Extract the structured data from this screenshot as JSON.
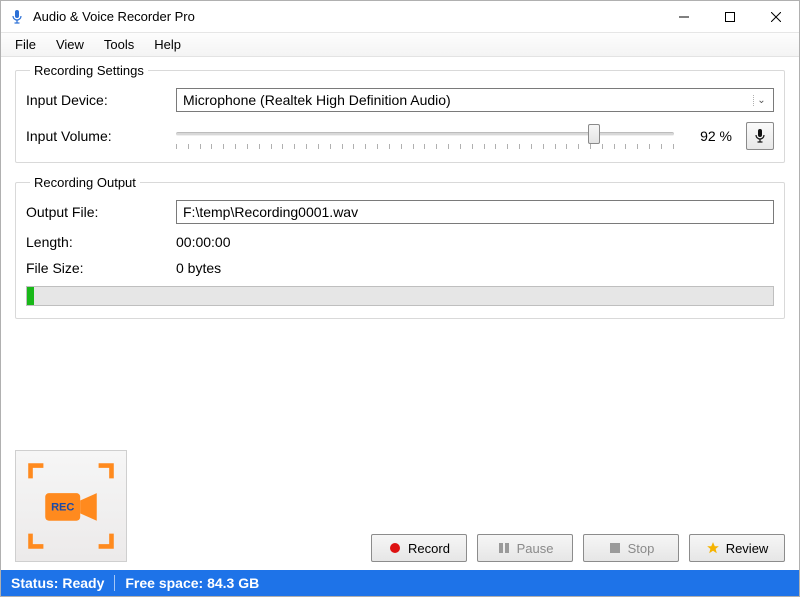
{
  "title": "Audio & Voice Recorder Pro",
  "menu": {
    "file": "File",
    "view": "View",
    "tools": "Tools",
    "help": "Help"
  },
  "settings": {
    "legend": "Recording Settings",
    "input_device_label": "Input Device:",
    "input_device_value": "Microphone (Realtek High Definition Audio)",
    "input_volume_label": "Input Volume:",
    "input_volume_pct": "92 %",
    "input_volume_value": 92
  },
  "output": {
    "legend": "Recording Output",
    "output_file_label": "Output File:",
    "output_file_value": "F:\\temp\\Recording0001.wav",
    "length_label": "Length:",
    "length_value": "00:00:00",
    "size_label": "File Size:",
    "size_value": "0 bytes",
    "progress_pct": 1
  },
  "buttons": {
    "record": "Record",
    "pause": "Pause",
    "stop": "Stop",
    "review": "Review"
  },
  "status": {
    "ready": "Status: Ready",
    "free_space": "Free space: 84.3 GB"
  },
  "colors": {
    "status_bg": "#1e73e8",
    "rec_orange": "#ff8a1e",
    "progress_green": "#18b818"
  }
}
